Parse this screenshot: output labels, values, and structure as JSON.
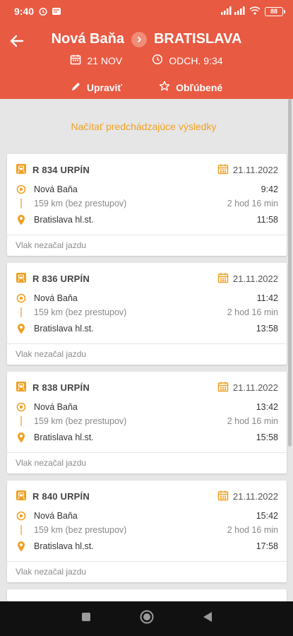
{
  "status_bar": {
    "time": "9:40",
    "battery": "88"
  },
  "header": {
    "from": "Nová Baňa",
    "to": "BRATISLAVA",
    "date": "21 NOV",
    "departure": "ODCH. 9:34",
    "edit_label": "Upraviť",
    "favorites_label": "Obľúbené"
  },
  "load_previous": "Načítať predchádzajúce výsledky",
  "results": [
    {
      "train": "R 834 URPÍN",
      "date": "21.11.2022",
      "from": "Nová Baňa",
      "dep": "9:42",
      "distance": "159 km (bez prestupov)",
      "duration": "2 hod 16 min",
      "to": "Bratislava hl.st.",
      "arr": "11:58",
      "status": "Vlak nezačal jazdu"
    },
    {
      "train": "R 836 URPÍN",
      "date": "21.11.2022",
      "from": "Nová Baňa",
      "dep": "11:42",
      "distance": "159 km (bez prestupov)",
      "duration": "2 hod 16 min",
      "to": "Bratislava hl.st.",
      "arr": "13:58",
      "status": "Vlak nezačal jazdu"
    },
    {
      "train": "R 838 URPÍN",
      "date": "21.11.2022",
      "from": "Nová Baňa",
      "dep": "13:42",
      "distance": "159 km (bez prestupov)",
      "duration": "2 hod 16 min",
      "to": "Bratislava hl.st.",
      "arr": "15:58",
      "status": "Vlak nezačal jazdu"
    },
    {
      "train": "R 840 URPÍN",
      "date": "21.11.2022",
      "from": "Nová Baňa",
      "dep": "15:42",
      "distance": "159 km (bez prestupov)",
      "duration": "2 hod 16 min",
      "to": "Bratislava hl.st.",
      "arr": "17:58",
      "status": "Vlak nezačal jazdu"
    }
  ],
  "colors": {
    "header": "#e85a42",
    "accent": "#f0a020",
    "nav": "#111111"
  },
  "icons": [
    "alarm-icon",
    "notification-icon",
    "signal-icon",
    "wifi-icon",
    "battery-icon",
    "back-arrow-icon",
    "chevron-right-icon",
    "calendar-icon",
    "clock-icon",
    "edit-icon",
    "star-icon",
    "train-icon",
    "origin-icon",
    "destination-pin-icon",
    "recents-icon",
    "home-icon",
    "back-icon"
  ]
}
